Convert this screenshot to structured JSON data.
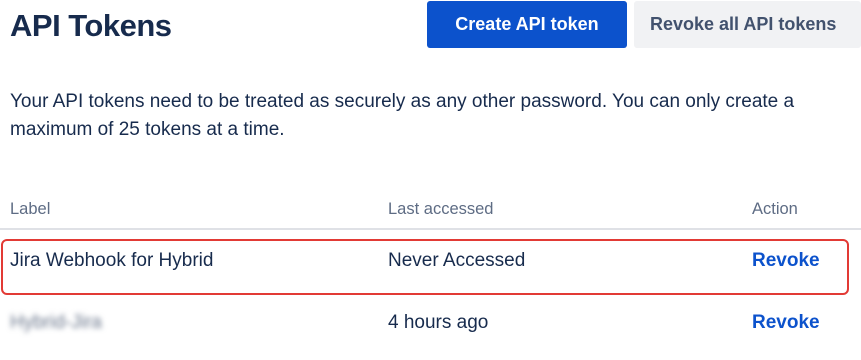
{
  "header": {
    "title": "API Tokens",
    "create_button_label": "Create API token",
    "revoke_all_button_label": "Revoke all API tokens"
  },
  "intro_text": "Your API tokens need to be treated as securely as any other password. You can only create a maximum of 25 tokens at a time.",
  "table": {
    "columns": [
      "Label",
      "Last accessed",
      "Action"
    ],
    "rows": [
      {
        "label": "Jira Webhook for Hybrid",
        "last_accessed": "Never Accessed",
        "action": "Revoke"
      },
      {
        "label": "Hybrid-Jira",
        "last_accessed": "4 hours ago",
        "action": "Revoke"
      }
    ]
  },
  "colors": {
    "primary": "#0c52cc",
    "highlight_border": "#e23a35",
    "text": "#172b4d",
    "muted": "#5e6c84"
  }
}
